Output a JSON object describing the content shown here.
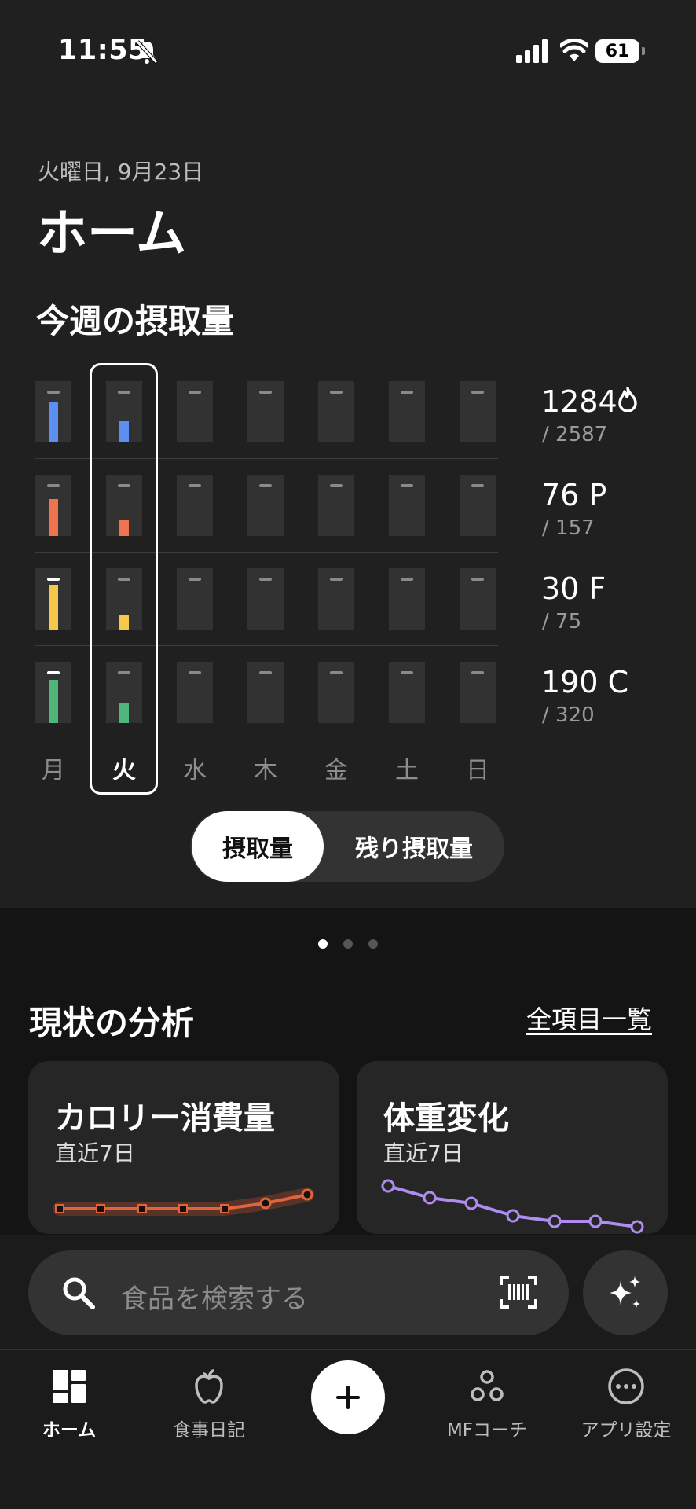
{
  "status_bar": {
    "time": "11:55",
    "battery": "61"
  },
  "header": {
    "date": "火曜日, 9月23日",
    "title": "ホーム"
  },
  "weekly": {
    "title": "今週の摂取量",
    "days": [
      "月",
      "火",
      "水",
      "木",
      "金",
      "土",
      "日"
    ],
    "selected_day": "火",
    "metrics": [
      {
        "key": "calories",
        "value": "1284",
        "goal": "/ 2587",
        "color": "#5b8ff0",
        "fill": [
          0.77,
          0.4,
          0,
          0,
          0,
          0,
          0
        ]
      },
      {
        "key": "protein",
        "value": "76 P",
        "goal": "/ 157",
        "color": "#f0734f",
        "fill": [
          0.69,
          0.3,
          0,
          0,
          0,
          0,
          0
        ]
      },
      {
        "key": "fat",
        "value": "30 F",
        "goal": "/ 75",
        "color": "#f5c84c",
        "fill": [
          0.84,
          0.26,
          0,
          0,
          0,
          0,
          0
        ]
      },
      {
        "key": "carbs",
        "value": "190 C",
        "goal": "/ 320",
        "color": "#4fb57a",
        "fill": [
          0.81,
          0.37,
          0,
          0,
          0,
          0,
          0
        ]
      }
    ],
    "toggle": {
      "selected": "摂取量",
      "other": "残り摂取量"
    }
  },
  "pager": {
    "count": 3,
    "active": 0
  },
  "analysis": {
    "title": "現状の分析",
    "link": "全項目一覧",
    "cards": [
      {
        "title": "カロリー消費量",
        "subtitle": "直近7日",
        "color": "#e0643c"
      },
      {
        "title": "体重変化",
        "subtitle": "直近7日",
        "color": "#b08cf0"
      }
    ]
  },
  "search": {
    "placeholder": "食品を検索する"
  },
  "nav": {
    "home": "ホーム",
    "diary": "食事日記",
    "coach": "MFコーチ",
    "settings": "アプリ設定"
  }
}
